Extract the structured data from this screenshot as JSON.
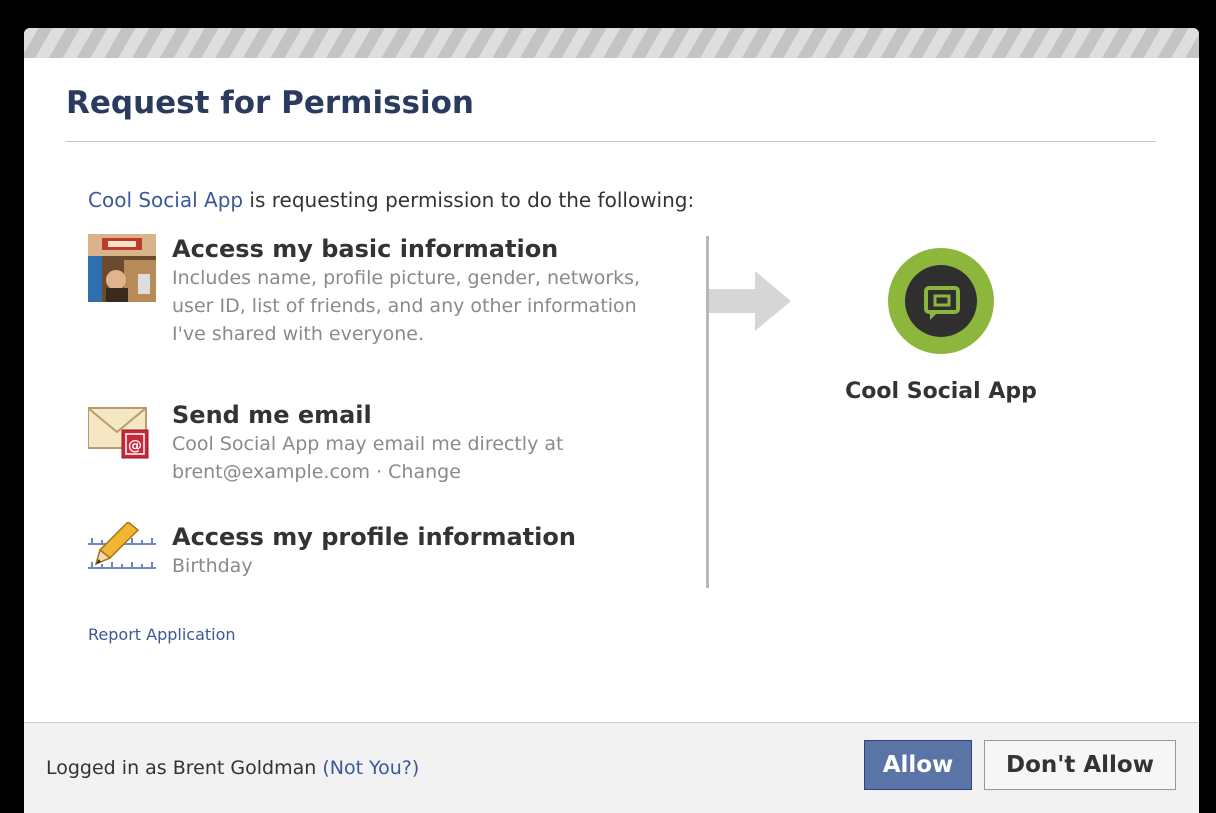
{
  "dialog": {
    "title": "Request for Permission",
    "intro": {
      "app_name": "Cool Social App",
      "text": " is requesting permission to do the following:"
    },
    "permissions": [
      {
        "icon": "profile-photo-icon",
        "title": "Access my basic information",
        "description": "Includes name, profile picture, gender, networks, user ID, list of friends, and any other information I've shared with everyone."
      },
      {
        "icon": "email-envelope-icon",
        "title": "Send me email",
        "description_prefix": "Cool Social App may email me directly at brent@example.com · ",
        "change_label": "Change"
      },
      {
        "icon": "pencil-ruler-icon",
        "title": "Access my profile information",
        "description": "Birthday"
      }
    ],
    "report_label": "Report Application",
    "app_panel": {
      "icon": "app-logo-icon",
      "name": "Cool Social App",
      "logo_color": "#8cb63c"
    }
  },
  "footer": {
    "logged_in_prefix": "Logged in as Brent Goldman ",
    "not_you_label": "(Not You?)",
    "allow_label": "Allow",
    "deny_label": "Don't Allow"
  },
  "colors": {
    "link": "#3b5998",
    "title": "#2a3b5e",
    "allow_button": "#5b74a8"
  }
}
